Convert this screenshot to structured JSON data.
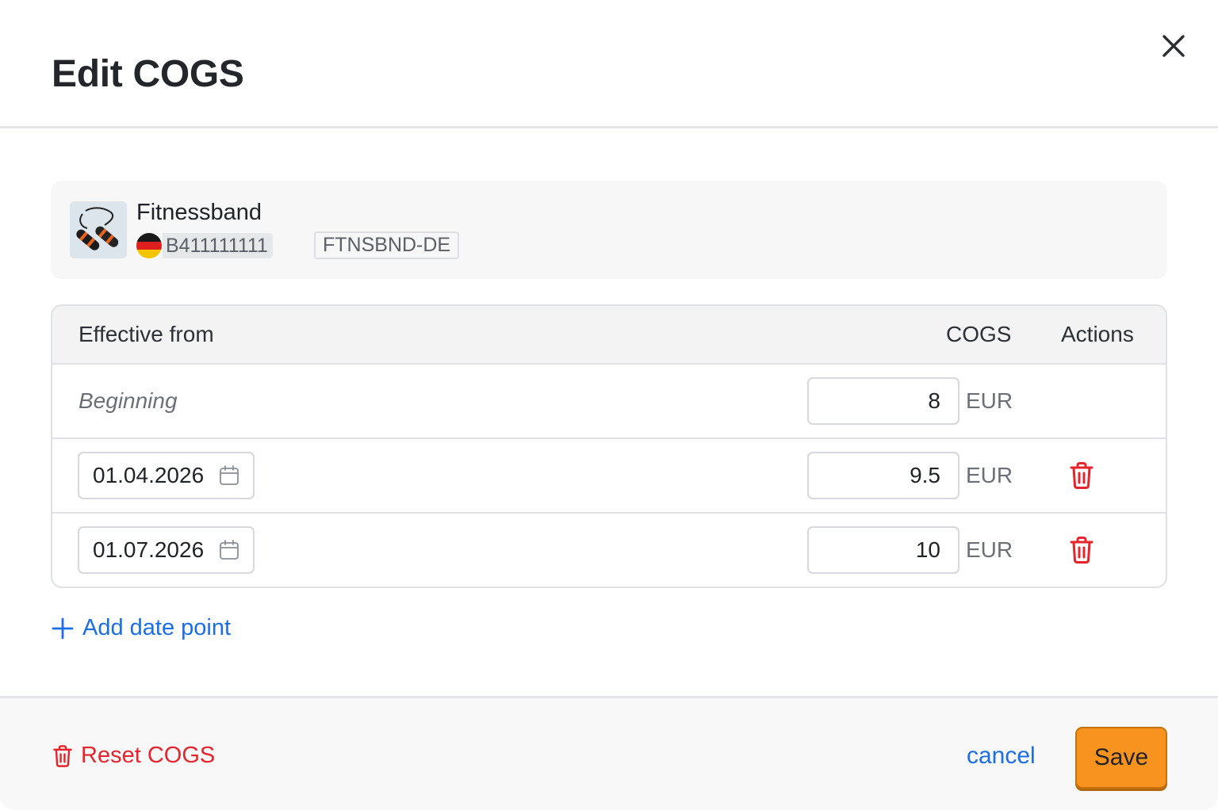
{
  "dialog": {
    "title": "Edit COGS"
  },
  "product": {
    "name": "Fitnessband",
    "marketplace_flag": "germany-flag-icon",
    "asin": "B411111111",
    "sku": "FTNSBND-DE"
  },
  "table": {
    "headers": {
      "effective_from": "Effective from",
      "cogs": "COGS",
      "actions": "Actions"
    },
    "rows": [
      {
        "date_label": "Beginning",
        "value": "8",
        "unit": "EUR"
      },
      {
        "date": "01.04.2026",
        "value": "9.5",
        "unit": "EUR"
      },
      {
        "date": "01.07.2026",
        "value": "10",
        "unit": "EUR"
      }
    ]
  },
  "add_date_point_label": "Add date point",
  "footer": {
    "reset_label": "Reset COGS",
    "cancel_label": "cancel",
    "save_label": "Save"
  },
  "colors": {
    "accent_blue": "#1a6ee6",
    "danger_red": "#e5242b",
    "save_orange": "#f7931e"
  }
}
